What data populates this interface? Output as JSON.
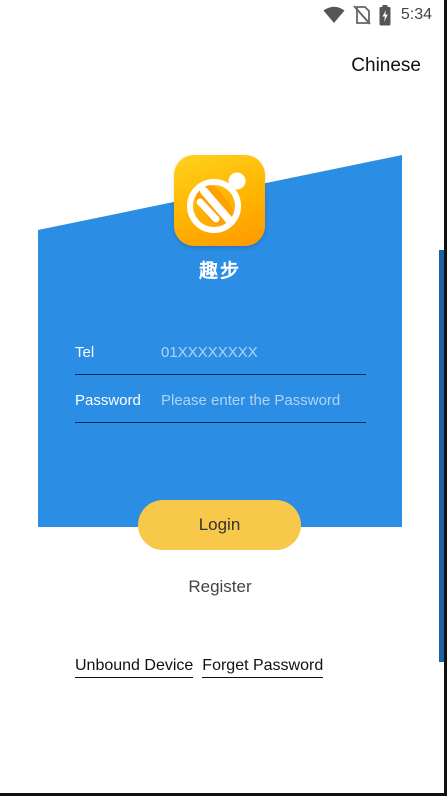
{
  "status_bar": {
    "time": "5:34",
    "icons": [
      "wifi-icon",
      "no-sim-icon",
      "battery-charging-icon"
    ]
  },
  "header": {
    "language_label": "Chinese"
  },
  "brand": {
    "app_name": "趣步",
    "logo_icon": "running-figure-icon"
  },
  "form": {
    "tel": {
      "label": "Tel",
      "placeholder": "01XXXXXXXX",
      "value": ""
    },
    "password": {
      "label": "Password",
      "placeholder": "Please enter the Password",
      "value": ""
    }
  },
  "actions": {
    "login_label": "Login",
    "register_label": "Register",
    "unbound_device_label": "Unbound Device",
    "forget_password_label": "Forget Password"
  },
  "colors": {
    "panel_blue": "#2b8de3",
    "login_yellow": "#f7c84a",
    "logo_orange": "#ffb400"
  }
}
